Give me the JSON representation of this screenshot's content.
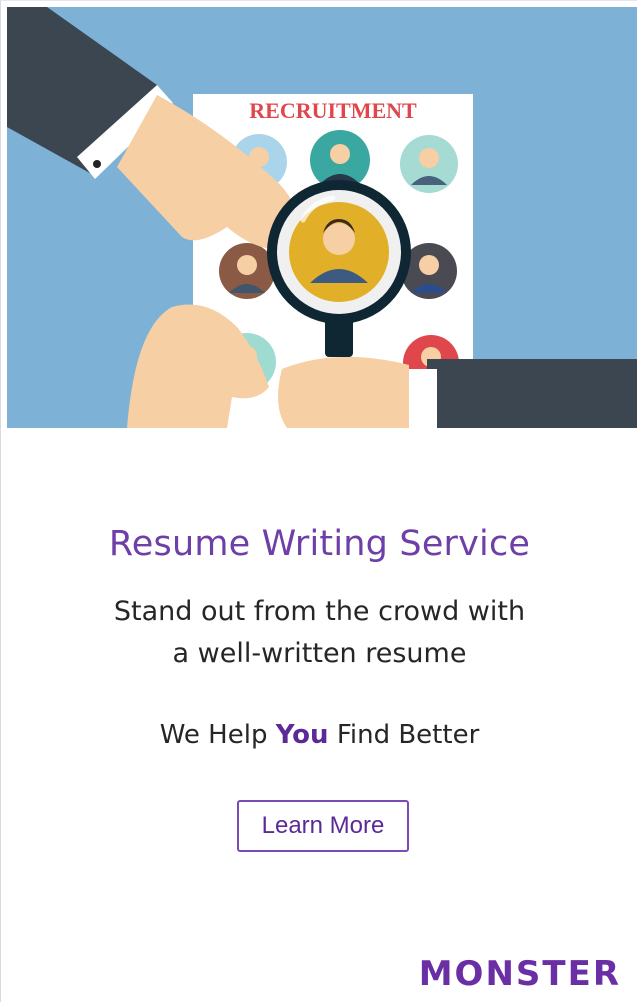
{
  "hero": {
    "poster_title": "RECRUITMENT"
  },
  "content": {
    "headline": "Resume Writing Service",
    "subheadline_line1": "Stand out from the crowd with",
    "subheadline_line2": "a well-written resume",
    "tagline_prefix": "We Help",
    "tagline_emphasis": "You",
    "tagline_suffix": "Find Better",
    "cta_label": "Learn More"
  },
  "brand": {
    "logo_text": "MONSTER"
  },
  "colors": {
    "hero_background": "#7db1d6",
    "brand_purple": "#6a2ea5",
    "poster_red": "#e0474c"
  }
}
